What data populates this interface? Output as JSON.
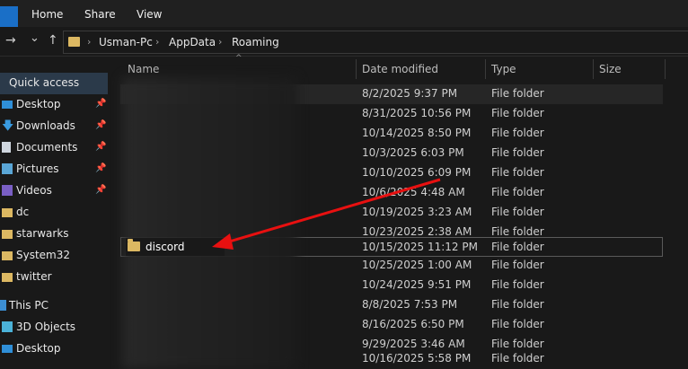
{
  "ribbon": {
    "tabs": [
      "Home",
      "Share",
      "View"
    ]
  },
  "nav": {
    "back": "←",
    "forward": "→",
    "recent": "⌄",
    "up": "↑"
  },
  "breadcrumb": [
    "Usman-Pc",
    "AppData",
    "Roaming"
  ],
  "sidebar": {
    "items": [
      {
        "label": "Quick access",
        "icon": "star-icon",
        "pinned": false
      },
      {
        "label": "Desktop",
        "icon": "desktop-icon",
        "pinned": true
      },
      {
        "label": "Downloads",
        "icon": "download-icon",
        "pinned": true
      },
      {
        "label": "Documents",
        "icon": "documents-icon",
        "pinned": true
      },
      {
        "label": "Pictures",
        "icon": "pictures-icon",
        "pinned": true
      },
      {
        "label": "Videos",
        "icon": "videos-icon",
        "pinned": true
      },
      {
        "label": "dc",
        "icon": "folder-icon",
        "pinned": false
      },
      {
        "label": "starwarks",
        "icon": "folder-icon",
        "pinned": false
      },
      {
        "label": "System32",
        "icon": "folder-icon",
        "pinned": false
      },
      {
        "label": "twitter",
        "icon": "folder-icon",
        "pinned": false
      },
      {
        "label": "This PC",
        "icon": "pc-icon",
        "pinned": false
      },
      {
        "label": "3D Objects",
        "icon": "3d-objects-icon",
        "pinned": false
      },
      {
        "label": "Desktop",
        "icon": "desktop-icon",
        "pinned": false
      }
    ]
  },
  "columns": {
    "name": "Name",
    "date": "Date modified",
    "type": "Type",
    "size": "Size"
  },
  "rows": [
    {
      "name": "",
      "date": "8/2/2025 9:37 PM",
      "type": "File folder"
    },
    {
      "name": "",
      "date": "8/31/2025 10:56 PM",
      "type": "File folder"
    },
    {
      "name": "",
      "date": "10/14/2025 8:50 PM",
      "type": "File folder"
    },
    {
      "name": "",
      "date": "10/3/2025 6:03 PM",
      "type": "File folder"
    },
    {
      "name": "",
      "date": "10/10/2025 6:09 PM",
      "type": "File folder"
    },
    {
      "name": "",
      "date": "10/6/2025 4:48 AM",
      "type": "File folder"
    },
    {
      "name": "",
      "date": "10/19/2025 3:23 AM",
      "type": "File folder"
    },
    {
      "name": "",
      "date": "10/23/2025 2:38 AM",
      "type": "File folder"
    },
    {
      "name": "discord",
      "date": "10/15/2025 11:12 PM",
      "type": "File folder"
    },
    {
      "name": "",
      "date": "10/25/2025 1:00 AM",
      "type": "File folder"
    },
    {
      "name": "",
      "date": "10/24/2025 9:51 PM",
      "type": "File folder"
    },
    {
      "name": "",
      "date": "8/8/2025 7:53 PM",
      "type": "File folder"
    },
    {
      "name": "",
      "date": "8/16/2025 6:50 PM",
      "type": "File folder"
    },
    {
      "name": "",
      "date": "9/29/2025 3:46 AM",
      "type": "File folder"
    },
    {
      "name": "",
      "date": "10/16/2025 5:58 PM",
      "type": "File folder"
    }
  ],
  "colors": {
    "folder": "#dcb862",
    "annotation_arrow": "#e81010",
    "quick_access_highlight": "#2b3a4a"
  }
}
